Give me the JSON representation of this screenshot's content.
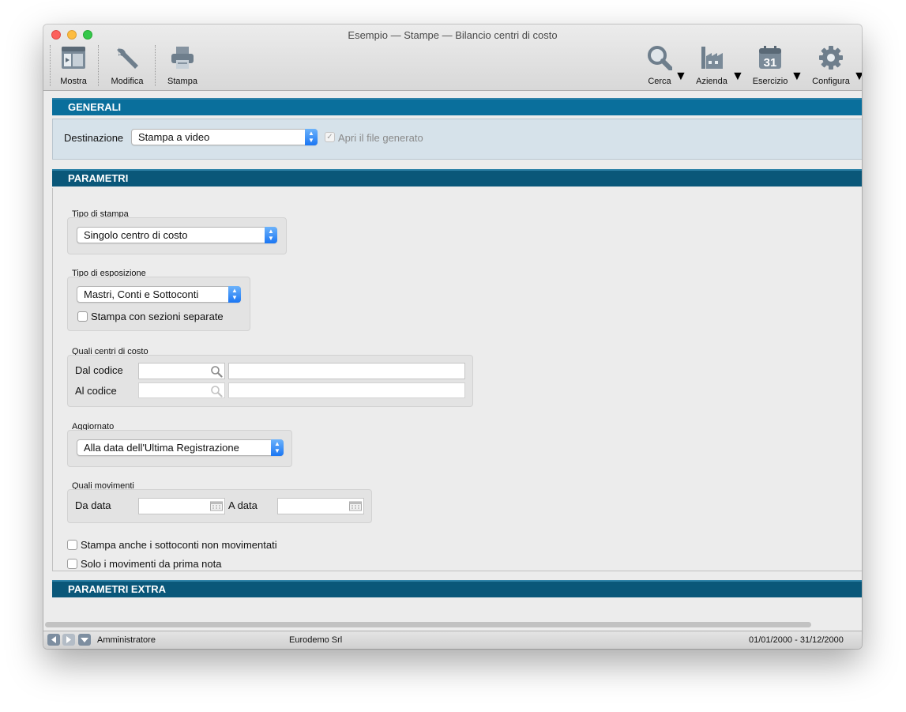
{
  "window": {
    "title": "Esempio — Stampe — Bilancio centri di costo"
  },
  "toolbar": {
    "mostra": "Mostra",
    "modifica": "Modifica",
    "stampa": "Stampa",
    "cerca": "Cerca",
    "azienda": "Azienda",
    "esercizio": "Esercizio",
    "configura": "Configura",
    "calendar_day": "31"
  },
  "generali": {
    "header": "GENERALI",
    "destinazione_label": "Destinazione",
    "destinazione_value": "Stampa a video",
    "apri_file_label": "Apri il file generato",
    "apri_file_checked": true
  },
  "parametri": {
    "header": "PARAMETRI",
    "tipo_stampa_label": "Tipo di stampa",
    "tipo_stampa_value": "Singolo centro di costo",
    "tipo_esposizione_label": "Tipo di esposizione",
    "tipo_esposizione_value": "Mastri, Conti e Sottoconti",
    "sezioni_separate_label": "Stampa con sezioni separate",
    "sezioni_separate_checked": false,
    "quali_centri_label": "Quali centri di costo",
    "dal_codice_label": "Dal codice",
    "dal_codice_value": "",
    "dal_codice_desc": "",
    "al_codice_label": "Al codice",
    "al_codice_value": "",
    "al_codice_desc": "",
    "aggiornato_label": "Aggiornato",
    "aggiornato_value": "Alla data dell'Ultima Registrazione",
    "quali_movimenti_label": "Quali movimenti",
    "da_data_label": "Da data",
    "da_data_value": "",
    "a_data_label": "A data",
    "a_data_value": "",
    "sottoconti_label": "Stampa anche i sottoconti non movimentati",
    "sottoconti_checked": false,
    "prima_nota_label": "Solo i movimenti da prima nota",
    "prima_nota_checked": false
  },
  "parametri_extra": {
    "header": "PARAMETRI EXTRA"
  },
  "statusbar": {
    "user": "Amministratore",
    "company": "Eurodemo Srl",
    "period": "01/01/2000 - 31/12/2000"
  },
  "colors": {
    "section_header": "#0a5779",
    "section_header_generali": "#0a6f9c",
    "generali_body": "#d6e2ea",
    "popup_accent": "#1a76f3"
  }
}
